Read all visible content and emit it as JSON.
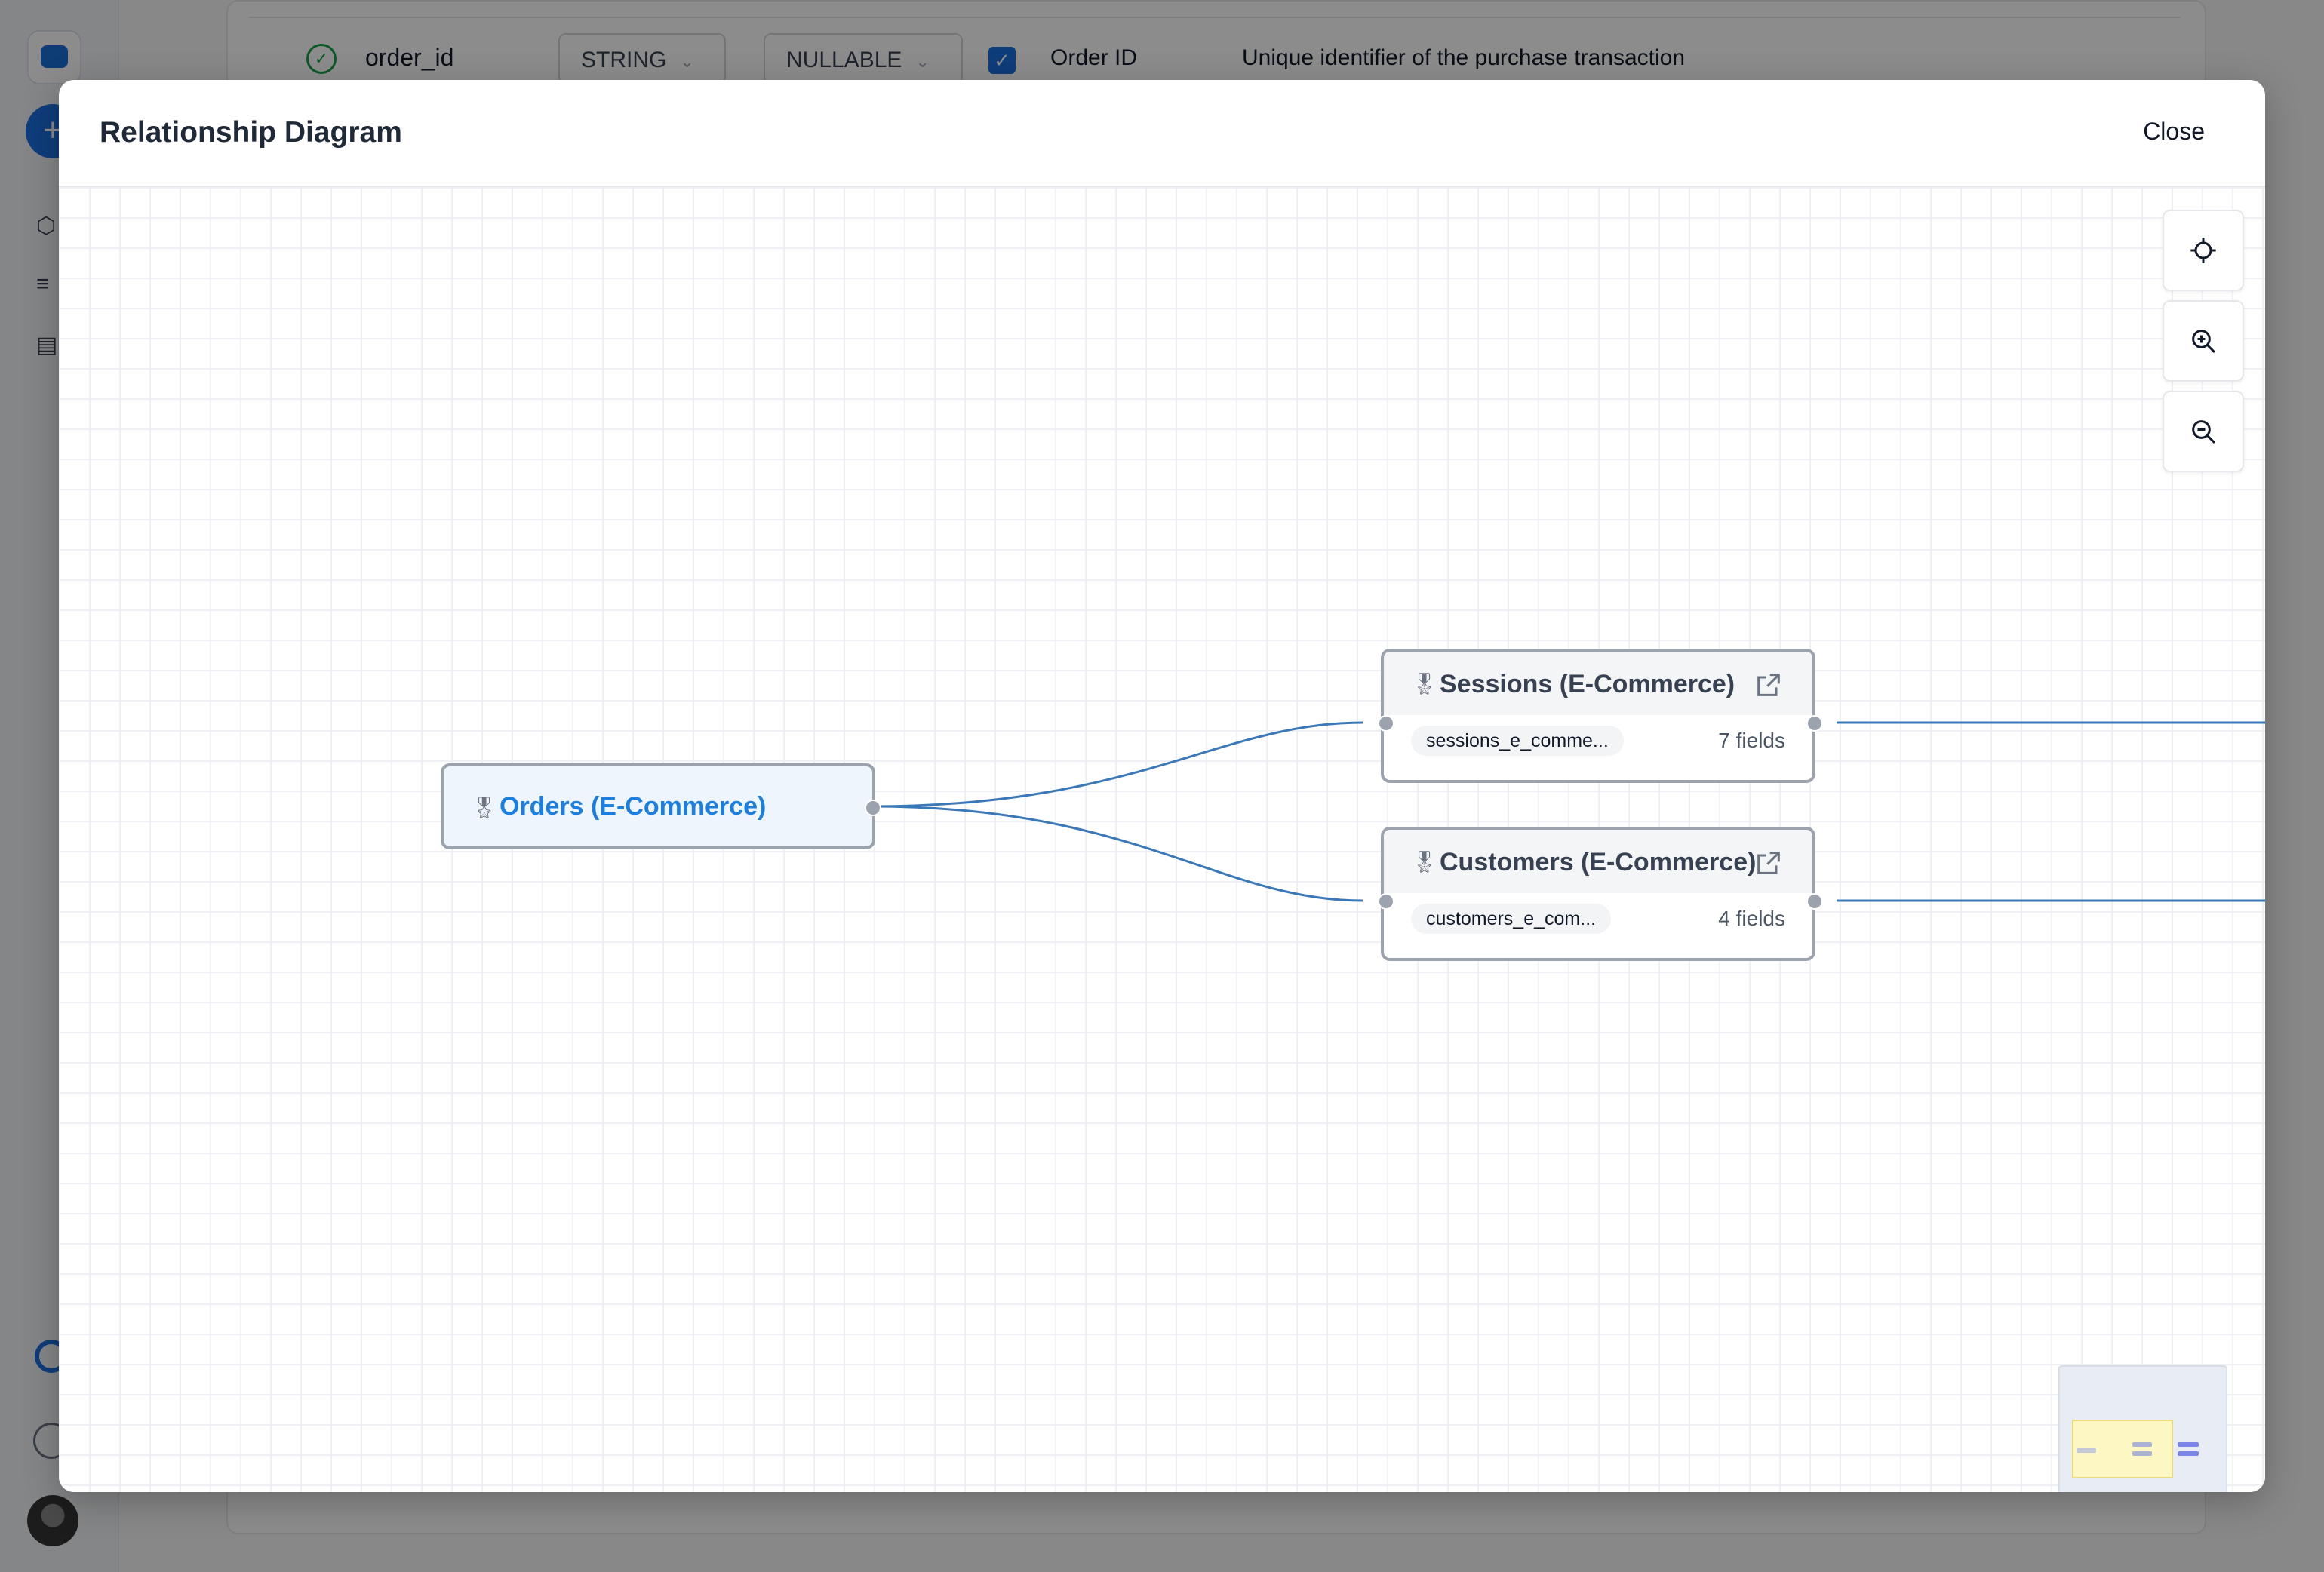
{
  "background": {
    "field_row": {
      "field_name": "order_id",
      "type": "STRING",
      "mode": "NULLABLE",
      "label": "Order ID",
      "description": "Unique identifier of the purchase transaction"
    }
  },
  "modal": {
    "title": "Relationship Diagram",
    "close_label": "Close"
  },
  "diagram": {
    "root_node": {
      "title": "Orders (E-Commerce)"
    },
    "nodes": [
      {
        "title": "Sessions (E-Commerce)",
        "table": "sessions_e_comme...",
        "fields": "7 fields"
      },
      {
        "title": "Customers (E-Commerce)",
        "table": "customers_e_com...",
        "fields": "4 fields"
      }
    ],
    "controls": [
      "fit-view-icon",
      "zoom-in-icon",
      "zoom-out-icon"
    ],
    "colors": {
      "edge": "#3b78b8",
      "root_title": "#1a7fe0",
      "node_border": "#9ca3af"
    }
  }
}
